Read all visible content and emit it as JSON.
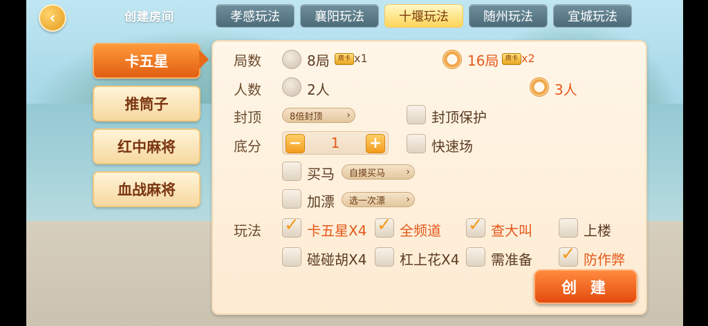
{
  "header": {
    "back_icon": "chevron-left-icon",
    "title": "创建房间",
    "tabs": [
      {
        "label": "孝感玩法"
      },
      {
        "label": "襄阳玩法"
      },
      {
        "label": "十堰玩法"
      },
      {
        "label": "随州玩法"
      },
      {
        "label": "宜城玩法"
      }
    ],
    "active_tab": "十堰玩法"
  },
  "sidebar": {
    "items": [
      {
        "label": "卡五星"
      },
      {
        "label": "推筒子"
      },
      {
        "label": "红中麻将"
      },
      {
        "label": "血战麻将"
      }
    ],
    "active": "卡五星"
  },
  "form": {
    "rounds": {
      "label": "局数",
      "options": [
        {
          "label": "8局",
          "cost_icon": "房卡",
          "cost": "x1",
          "selected": false
        },
        {
          "label": "16局",
          "cost_icon": "房卡",
          "cost": "x2",
          "selected": true
        }
      ]
    },
    "players": {
      "label": "人数",
      "options": [
        {
          "label": "2人",
          "selected": false
        },
        {
          "label": "3人",
          "selected": true
        }
      ]
    },
    "cap": {
      "label": "封顶",
      "dropdown": "8倍封顶",
      "protect_label": "封顶保护",
      "protect_checked": false
    },
    "base": {
      "label": "底分",
      "value": "1",
      "minus": "−",
      "plus": "+",
      "quick_label": "快速场",
      "quick_checked": false
    },
    "buy_horse": {
      "label": "买马",
      "checked": false,
      "dropdown": "自摸买马"
    },
    "piao": {
      "label": "加漂",
      "checked": false,
      "dropdown": "选一次漂"
    },
    "rules": {
      "label": "玩法",
      "items": [
        {
          "label": "卡五星X4",
          "checked": true
        },
        {
          "label": "全频道",
          "checked": true
        },
        {
          "label": "查大叫",
          "checked": true
        },
        {
          "label": "上楼",
          "checked": false
        },
        {
          "label": "碰碰胡X4",
          "checked": false
        },
        {
          "label": "杠上花X4",
          "checked": false
        },
        {
          "label": "需准备",
          "checked": false
        },
        {
          "label": "防作弊",
          "checked": true
        }
      ]
    },
    "check_glyph": "✓",
    "arrow_glyph": "›",
    "create_label": "创 建"
  }
}
